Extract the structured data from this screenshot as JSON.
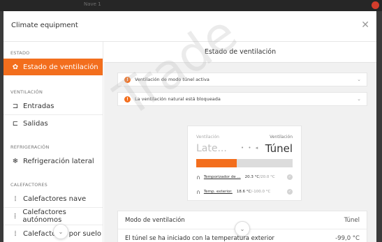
{
  "window": {
    "title": "Nave 1"
  },
  "modal": {
    "title": "Climate equipment",
    "close_glyph": "✕"
  },
  "sidebar": {
    "sections": [
      {
        "header": "ESTADO",
        "items": [
          {
            "label": "Estado de ventilación",
            "icon": "fan-icon",
            "glyph": "✿",
            "active": true
          }
        ]
      },
      {
        "header": "VENTILACIÓN",
        "items": [
          {
            "label": "Entradas",
            "icon": "inlet-icon",
            "glyph": "⊐"
          },
          {
            "label": "Salidas",
            "icon": "outlet-icon",
            "glyph": "⊏"
          }
        ]
      },
      {
        "header": "REFRIGERACIÓN",
        "items": [
          {
            "label": "Refrigeración lateral",
            "icon": "cooling-icon",
            "glyph": "❄"
          }
        ]
      },
      {
        "header": "CALEFACTORES",
        "items": [
          {
            "label": "Calefactores nave",
            "icon": "heater-icon",
            "glyph": "⦙"
          },
          {
            "label": "Calefactores autónomos",
            "icon": "heater-icon",
            "glyph": "⦙"
          },
          {
            "label": "Calefactores por suelo",
            "icon": "heater-icon",
            "glyph": "⦙"
          }
        ]
      }
    ]
  },
  "main": {
    "header": "Estado de ventilación",
    "alerts": [
      {
        "text": "Ventilación de modo túnel activa",
        "icon_glyph": "!"
      },
      {
        "text": "La ventilación natural está bloqueada",
        "icon_glyph": "!"
      }
    ],
    "card": {
      "left_label": "Ventilación",
      "left_value": "Late...",
      "right_label": "Ventilación",
      "right_value": "Túnel",
      "dots": "• • ◂",
      "progress": 0.42,
      "rows": [
        {
          "name": "Temporizador de ...",
          "value": "20.3 °C",
          "sep": " / ",
          "target": "20.0 °C"
        },
        {
          "name": "Temp. exterior.",
          "value": "18.6 °C",
          "sep": " / ",
          "target": "-100.0 °C"
        }
      ]
    },
    "table": [
      {
        "key": "Modo de ventilación",
        "value": "Túnel"
      },
      {
        "key": "El túnel se ha iniciado con la temperatura exterior",
        "value": "-99,0 °C"
      }
    ]
  },
  "watermark": "Trade"
}
